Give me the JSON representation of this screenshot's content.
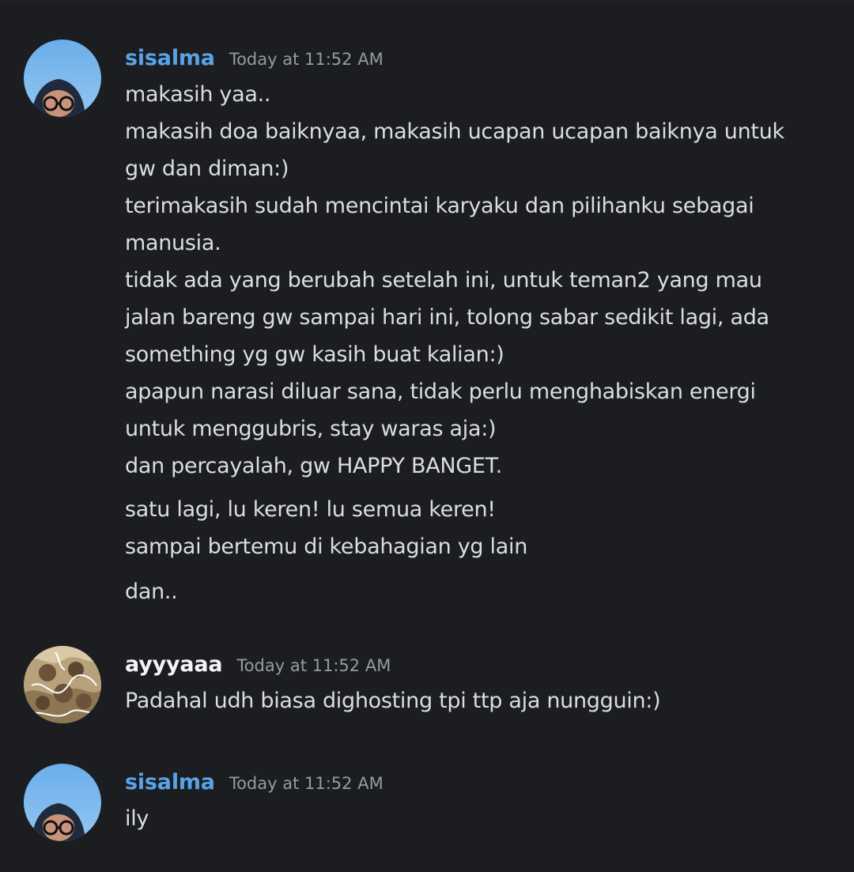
{
  "messages": [
    {
      "username": "sisalma",
      "username_color": "#5aa2e6",
      "timestamp": "Today at 11:52 AM",
      "lines": [
        "makasih yaa..",
        "makasih doa baiknyaa, makasih ucapan ucapan baiknya untuk",
        "gw dan diman:)",
        "terimakasih sudah mencintai karyaku dan pilihanku sebagai",
        "manusia.",
        "tidak ada yang berubah setelah ini, untuk teman2 yang mau",
        "jalan bareng gw sampai hari ini, tolong sabar sedikit lagi, ada",
        "something yg gw kasih buat kalian:)",
        "apapun narasi diluar sana, tidak perlu menghabiskan energi",
        "untuk menggubris, stay waras aja:)",
        "dan percayalah, gw HAPPY BANGET.",
        "satu lagi, lu keren! lu semua keren!",
        "sampai bertemu di kebahagian yg lain",
        "dan.."
      ]
    },
    {
      "username": "ayyyaaa",
      "username_color": "#f2f3f5",
      "timestamp": "Today at 11:52 AM",
      "lines": [
        "Padahal udh biasa dighosting tpi ttp aja nungguin:)"
      ]
    },
    {
      "username": "sisalma",
      "username_color": "#5aa2e6",
      "timestamp": "Today at 11:52 AM",
      "lines": [
        "ily"
      ]
    }
  ],
  "colors": {
    "background": "#1c1d21",
    "text": "#dbdee1",
    "timestamp": "#949ba4"
  }
}
